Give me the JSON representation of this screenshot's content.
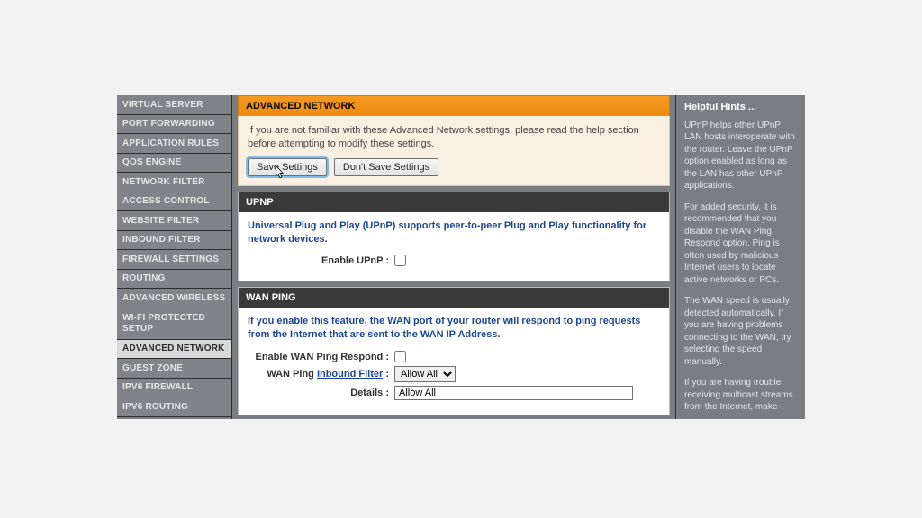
{
  "sidebar": {
    "items": [
      {
        "label": "VIRTUAL SERVER"
      },
      {
        "label": "PORT FORWARDING"
      },
      {
        "label": "APPLICATION RULES"
      },
      {
        "label": "QOS ENGINE"
      },
      {
        "label": "NETWORK FILTER"
      },
      {
        "label": "ACCESS CONTROL"
      },
      {
        "label": "WEBSITE FILTER"
      },
      {
        "label": "INBOUND FILTER"
      },
      {
        "label": "FIREWALL SETTINGS"
      },
      {
        "label": "ROUTING"
      },
      {
        "label": "ADVANCED WIRELESS"
      },
      {
        "label": "WI-FI PROTECTED SETUP"
      },
      {
        "label": "ADVANCED NETWORK"
      },
      {
        "label": "GUEST ZONE"
      },
      {
        "label": "IPV6 FIREWALL"
      },
      {
        "label": "IPV6 ROUTING"
      }
    ],
    "selected_index": 12
  },
  "intro": {
    "header": "ADVANCED NETWORK",
    "text": "If you are not familiar with these Advanced Network settings, please read the help section before attempting to modify these settings.",
    "save_label": "Save Settings",
    "dont_save_label": "Don't Save Settings"
  },
  "upnp": {
    "header": "UPNP",
    "desc": "Universal Plug and Play (UPnP) supports peer-to-peer Plug and Play functionality for network devices.",
    "enable_label": "Enable UPnP :",
    "enabled": false
  },
  "wan_ping": {
    "header": "WAN PING",
    "desc": "If you enable this feature, the WAN port of your router will respond to ping requests from the Internet that are sent to the WAN IP Address.",
    "enable_label": "Enable WAN Ping Respond :",
    "enabled": false,
    "filter_label_prefix": "WAN Ping ",
    "filter_label_link": "Inbound Filter",
    "filter_label_suffix": " :",
    "filter_options": [
      "Allow All"
    ],
    "filter_value": "Allow All",
    "details_label": "Details :",
    "details_value": "Allow All"
  },
  "hints": {
    "title": "Helpful Hints ...",
    "p1": "UPnP helps other UPnP LAN hosts interoperate with the router. Leave the UPnP option enabled as long as the LAN has other UPnP applications.",
    "p2": "For added security, it is recommended that you disable the WAN Ping Respond option. Ping is often used by malicious Internet users to locate active networks or PCs.",
    "p3": "The WAN speed is usually detected automatically. If you are having problems connecting to the WAN, try selecting the speed manually.",
    "p4": "If you are having trouble receiving multicast streams from the Internet, make"
  }
}
